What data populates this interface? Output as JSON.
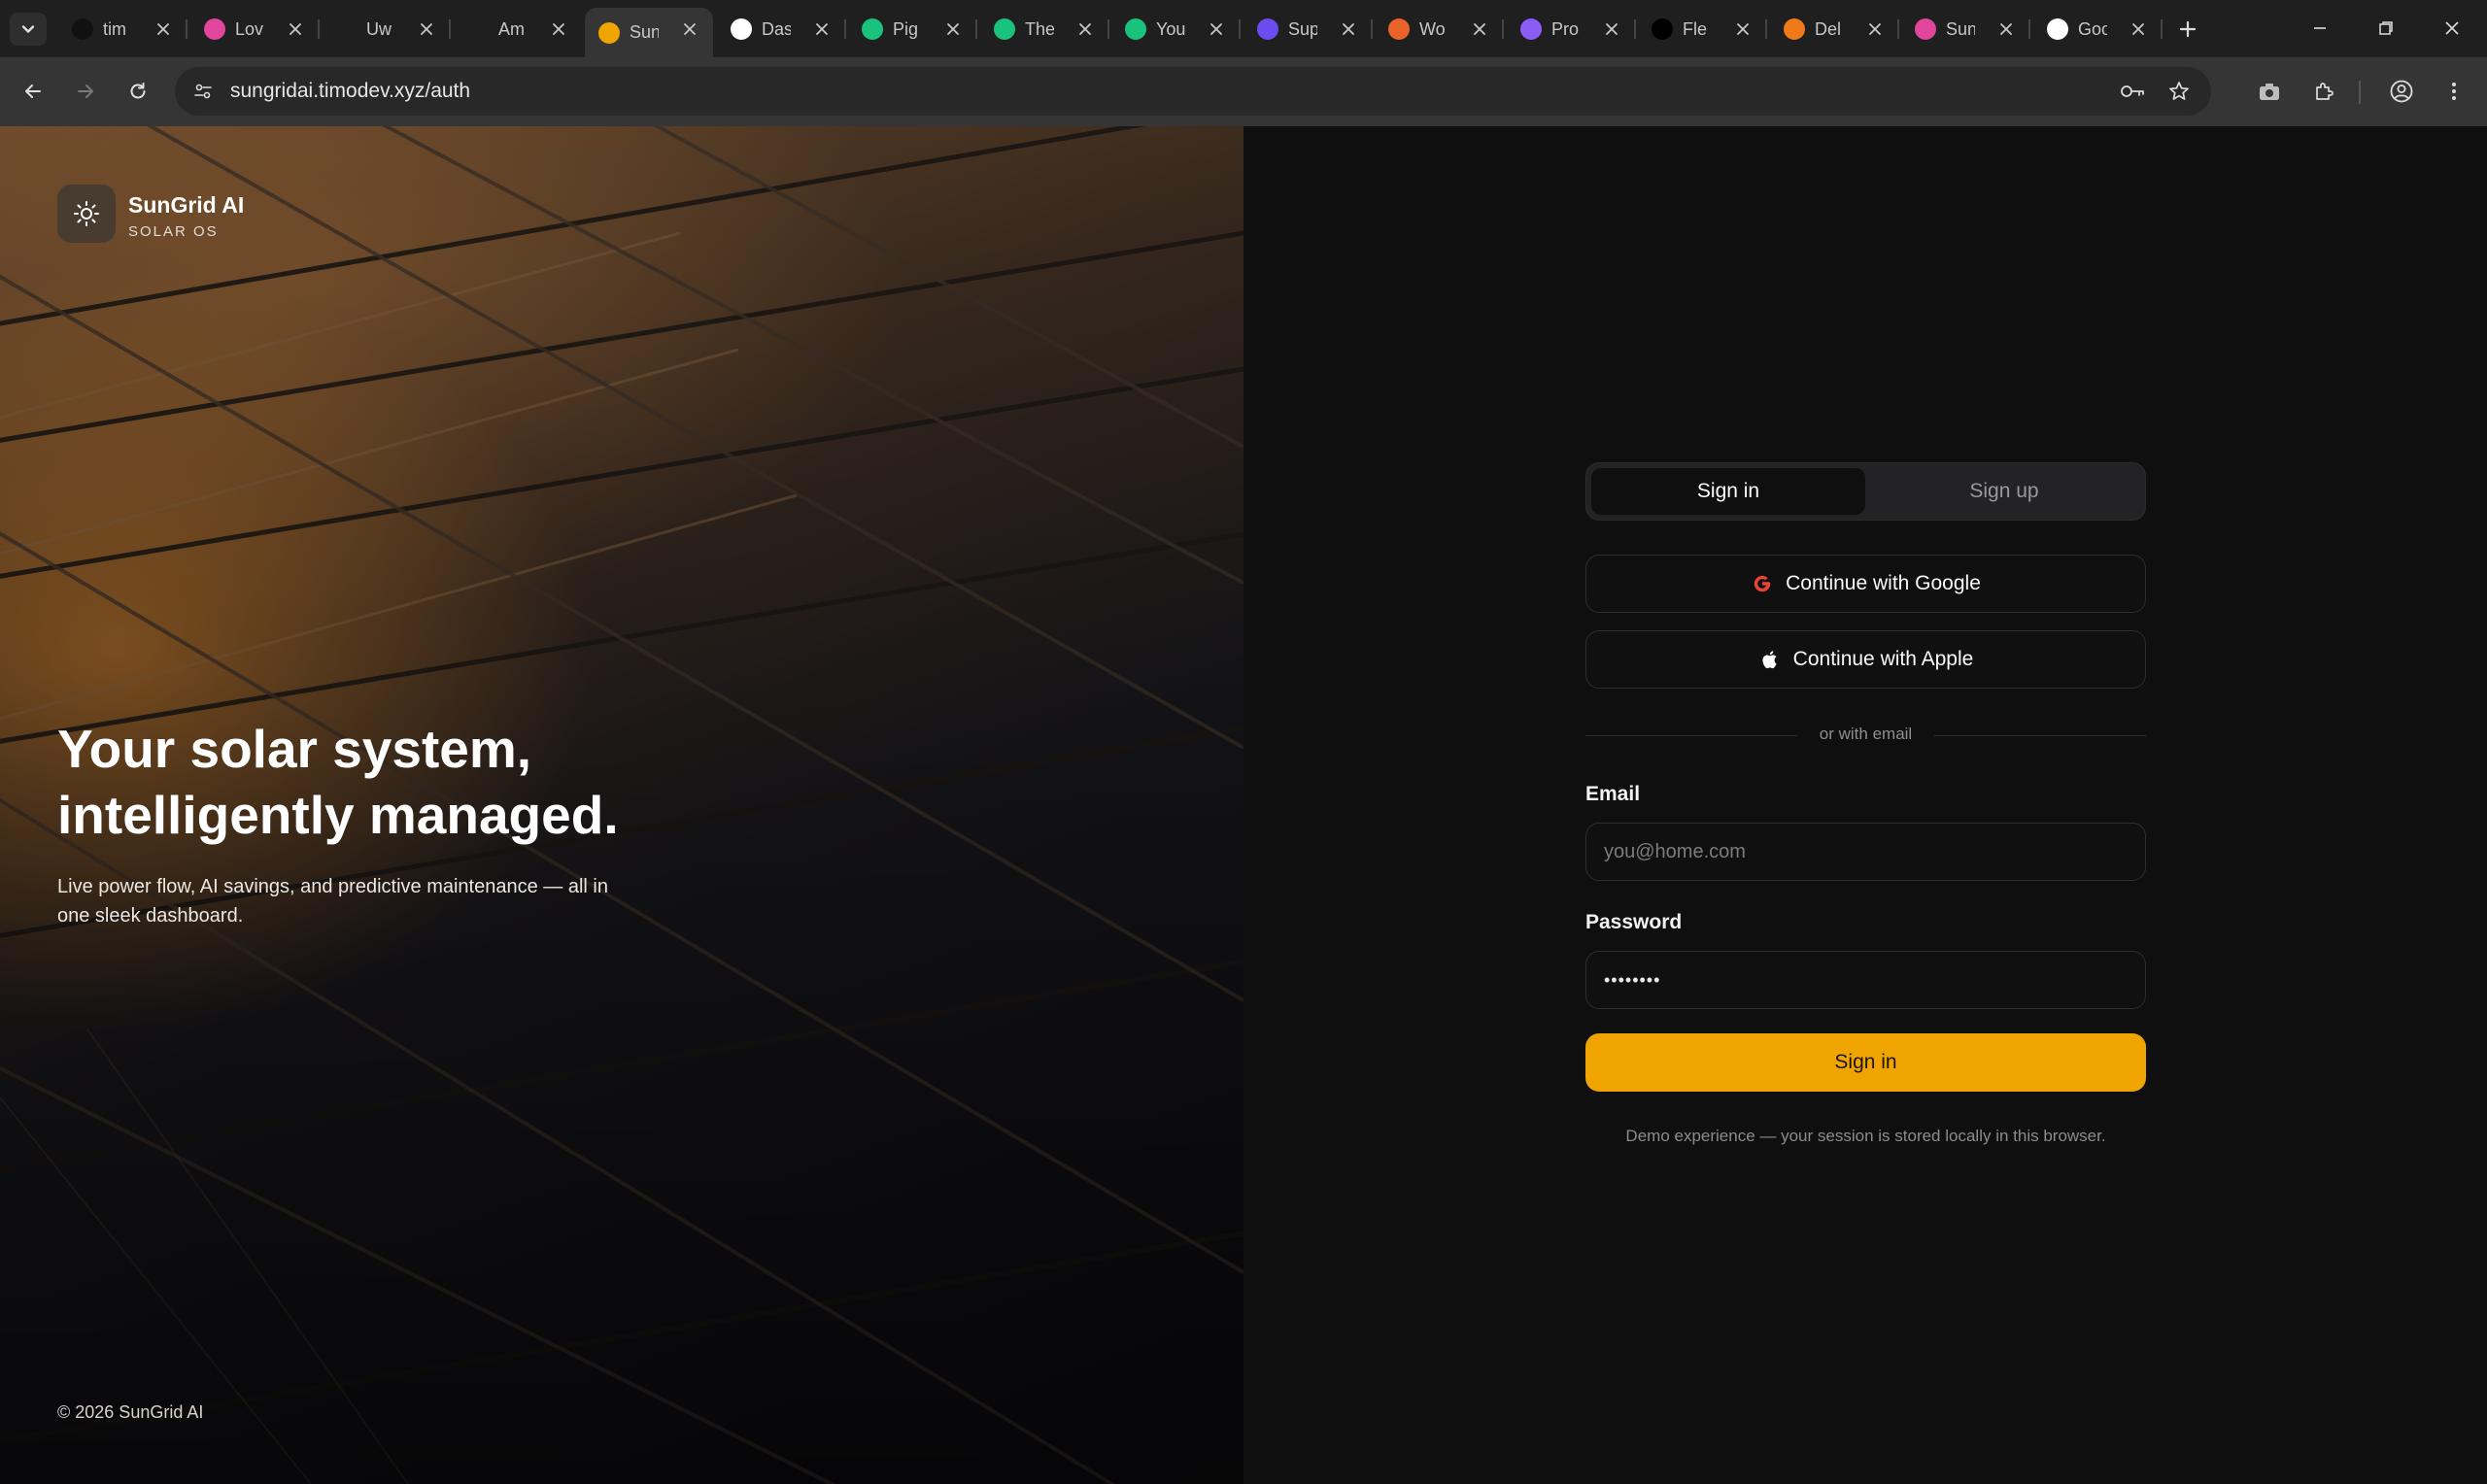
{
  "browser": {
    "tabs": [
      {
        "label": "tim",
        "icon": "github-icon",
        "color": "#111111"
      },
      {
        "label": "Lov",
        "icon": "lovable-heart-icon",
        "color": "#e2459c"
      },
      {
        "label": "Uw",
        "icon": "sparkle-icon",
        "color": "#1f1f1f"
      },
      {
        "label": "Am",
        "icon": "sparkle-icon",
        "color": "#1f1f1f"
      },
      {
        "label": "Sun",
        "icon": "sun-favicon-icon",
        "color": "#f0a400"
      },
      {
        "label": "Das",
        "icon": "dashboard-favicon-icon",
        "color": "#ffffff"
      },
      {
        "label": "Pig",
        "icon": "chatgpt-icon",
        "color": "#19c37d"
      },
      {
        "label": "The",
        "icon": "chatgpt-icon",
        "color": "#19c37d"
      },
      {
        "label": "You",
        "icon": "chatgpt-icon",
        "color": "#19c37d"
      },
      {
        "label": "Sup",
        "icon": "s-favicon-icon",
        "color": "#6c4cf0"
      },
      {
        "label": "Wo",
        "icon": "w-favicon-icon",
        "color": "#e8622a"
      },
      {
        "label": "Pro",
        "icon": "doc-favicon-icon",
        "color": "#8b5cf6"
      },
      {
        "label": "Fle",
        "icon": "flex-favicon-icon",
        "color": "#000000"
      },
      {
        "label": "Del",
        "icon": "d-favicon-icon",
        "color": "#f07a1a"
      },
      {
        "label": "Sun",
        "icon": "lovable-heart-icon",
        "color": "#e2459c"
      },
      {
        "label": "Goo",
        "icon": "google-icon",
        "color": "#ffffff"
      }
    ],
    "active_tab_index": 4,
    "url": "sungridai.timodev.xyz/auth"
  },
  "brand": {
    "name": "SunGrid AI",
    "tagline": "SOLAR OS"
  },
  "hero": {
    "title": "Your solar system, intelligently managed.",
    "description": "Live power flow, AI savings, and predictive maintenance — all in one sleek dashboard.",
    "footer": "© 2026 SunGrid AI"
  },
  "auth": {
    "tab_signin": "Sign in",
    "tab_signup": "Sign up",
    "google_label": "Continue with Google",
    "apple_label": "Continue with Apple",
    "divider_text": "or with email",
    "email_label": "Email",
    "email_placeholder": "you@home.com",
    "password_label": "Password",
    "password_value": "••••••••",
    "submit_label": "Sign in",
    "note": "Demo experience — your session is stored locally in this browser."
  },
  "colors": {
    "accent": "#f0a400",
    "background": "#0f0f10"
  }
}
